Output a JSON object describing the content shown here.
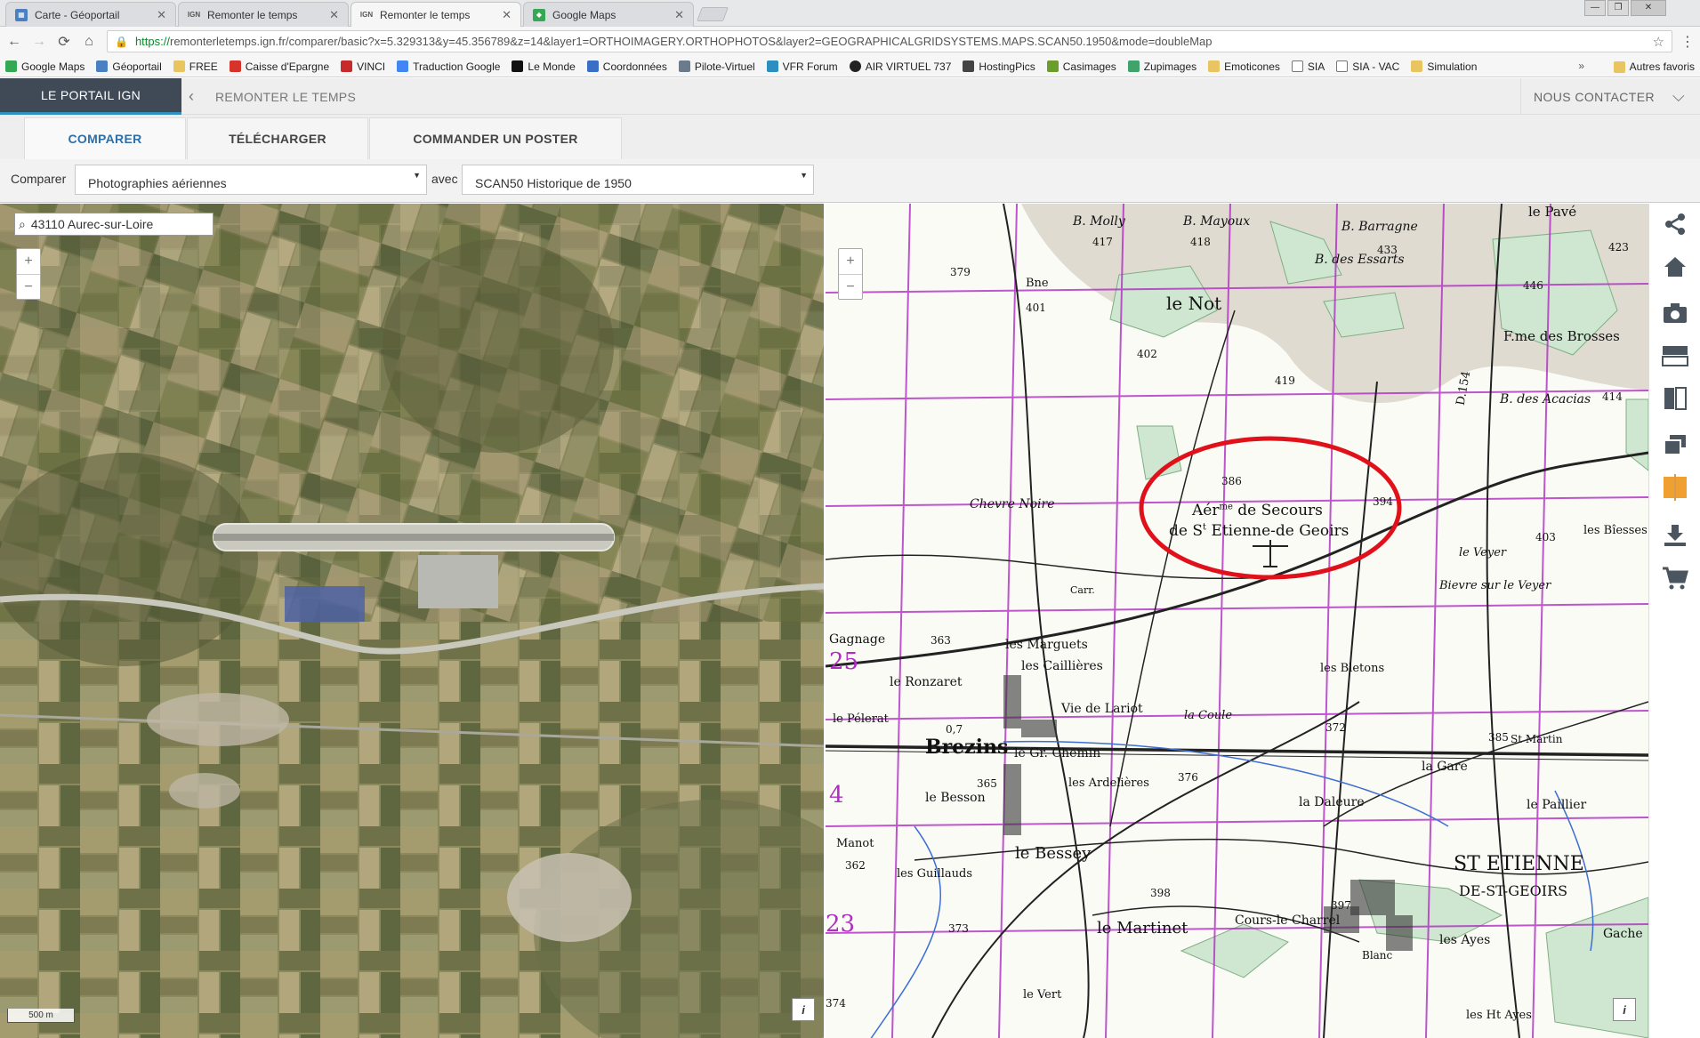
{
  "browser": {
    "tabs": [
      {
        "label": "Carte - Géoportail",
        "icon": "geoportail-favicon"
      },
      {
        "label": "Remonter le temps",
        "icon": "ign-favicon"
      },
      {
        "label": "Remonter le temps",
        "icon": "ign-favicon"
      },
      {
        "label": "Google Maps",
        "icon": "google-maps-favicon"
      }
    ],
    "tab_prefix_ign": "IGN",
    "url_scheme": "https://",
    "url_rest": "remonterletemps.ign.fr/comparer/basic?x=5.329313&y=45.356789&z=14&layer1=ORTHOIMAGERY.ORTHOPHOTOS&layer2=GEOGRAPHICALGRIDSYSTEMS.MAPS.SCAN50.1950&mode=doubleMap",
    "bookmarks": [
      "Google Maps",
      "Géoportail",
      "FREE",
      "Caisse d'Epargne",
      "VINCI",
      "Traduction Google",
      "Le Monde",
      "Coordonnées",
      "Pilote-Virtuel",
      "VFR Forum",
      "AIR VIRTUEL 737",
      "HostingPics",
      "Casimages",
      "Zupimages",
      "Emoticones",
      "SIA",
      "SIA - VAC",
      "Simulation"
    ],
    "bookmarks_more": "»",
    "bookmarks_other": "Autres favoris"
  },
  "header": {
    "portal_label": "LE PORTAIL IGN",
    "breadcrumb": "REMONTER LE TEMPS",
    "contact_label": "NOUS CONTACTER"
  },
  "subnav": {
    "tabs": [
      "COMPARER",
      "TÉLÉCHARGER",
      "COMMANDER UN POSTER"
    ]
  },
  "compare": {
    "label": "Comparer",
    "left_layer": "Photographies aériennes",
    "with_label": "avec",
    "right_layer": "SCAN50 Historique de 1950"
  },
  "left_map": {
    "search_value": "43110 Aurec-sur-Loire",
    "zoom_in": "+",
    "zoom_out": "−",
    "scale": "500 m",
    "info": "i"
  },
  "right_map": {
    "zoom_in": "+",
    "zoom_out": "−",
    "info": "i",
    "labels": {
      "aero_line1": "Aér",
      "aero_sup": "me",
      "aero_line1b": "de Secours",
      "aero_line2": "de S",
      "aero_sup2": "t",
      "aero_line2b": "Etienne-de Geoirs",
      "not": "le Not",
      "essarts": "B. des Essarts",
      "mayoux": "B. Mayoux",
      "barragne": "B. Barragne",
      "molly": "B. Molly",
      "pave": "le Pavé",
      "brosses": "F.me des Brosses",
      "acacias": "B. des Acacias",
      "chevre": "Chevre Noire",
      "bievre": "Bievre sur le Veyer",
      "veyer": "le Veyer",
      "blesses": "les Bîesses",
      "marguets": "les Marguets",
      "ronzaret": "le Ronzaret",
      "caillieres": "les Caillières",
      "gagnage": "Gagnage",
      "lariot": "Vie de Lariot",
      "coule": "la Coule",
      "bletons": "les Bletons",
      "brezins": "Brezins",
      "grchemin": "le Gr. Chemin",
      "pelerat": "le Pélerat",
      "ardelieres": "les Ardelières",
      "besson": "le Besson",
      "bessey": "le Bessey",
      "gare": "la Gare",
      "daleure": "la Daleure",
      "paillier": "le Paillier",
      "stmartin": "St Martin",
      "stetienne": "ST ETIENNE",
      "degeoirs": "DE-ST-GEOIRS",
      "guillauds": "les Guillauds",
      "manot": "Manot",
      "martinet": "le Martinet",
      "cours": "Cours-le Charrel",
      "ayes": "les Ayes",
      "gache": "Gache",
      "blanc": "Blanc",
      "vert": "le Vert",
      "hautayes": "les Ht Ayes",
      "grid25": "25",
      "grid4": "4",
      "grid23": "23",
      "e379": "379",
      "e401": "401",
      "e417": "417",
      "e418": "418",
      "e433": "433",
      "e446": "446",
      "e423": "423",
      "e402": "402",
      "e419": "419",
      "e414": "414",
      "e386": "386",
      "e394": "394",
      "e403": "403",
      "e363": "363",
      "e365": "365",
      "e376": "376",
      "e372": "372",
      "e385": "385",
      "e362": "362",
      "e373": "373",
      "e398": "398",
      "e397": "397",
      "e374": "374",
      "e07": "0,7",
      "d154": "D.154",
      "carr": "Carr.",
      "bne": "Bne"
    }
  },
  "colors": {
    "portal_bg": "#3f4a56",
    "accent_blue": "#2e6fa8",
    "grid_magenta": "#b02cc4",
    "highlight_red": "#e0111b",
    "active_compare_icon": "#f0a030"
  }
}
